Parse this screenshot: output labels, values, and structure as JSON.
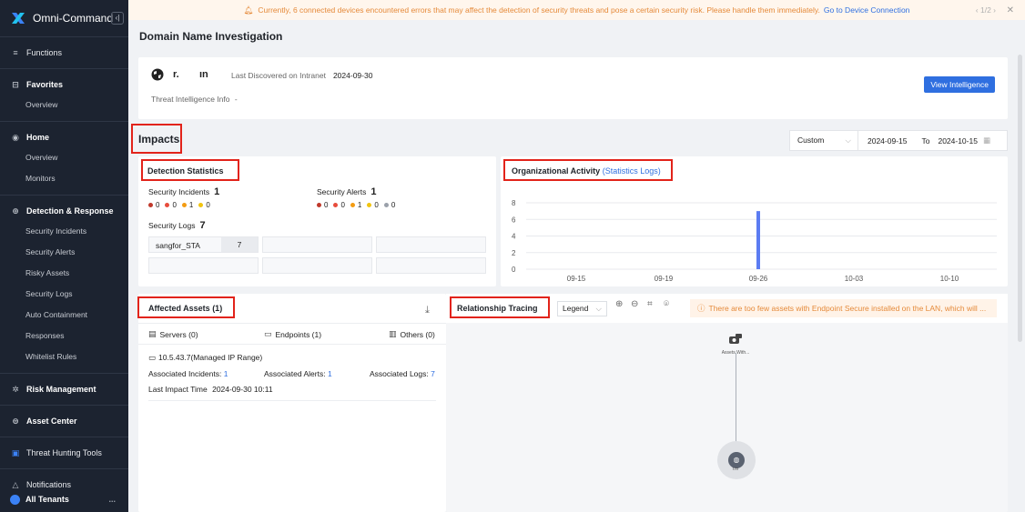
{
  "sidebar": {
    "brand": "Omni-Command",
    "collapse_icon": "‹|",
    "groups": [
      {
        "label": "Functions",
        "icon": "≡"
      },
      {
        "label": "Favorites",
        "icon": "⊟",
        "items": [
          "Overview"
        ]
      },
      {
        "label": "Home",
        "icon": "◉",
        "items": [
          "Overview",
          "Monitors"
        ]
      },
      {
        "label": "Detection & Response",
        "icon": "⊕",
        "items": [
          "Security Incidents",
          "Security Alerts",
          "Risky Assets",
          "Security Logs",
          "Auto Containment",
          "Responses",
          "Whitelist Rules"
        ]
      },
      {
        "label": "Risk Management",
        "icon": "✲"
      },
      {
        "label": "Asset Center",
        "icon": "⊜"
      },
      {
        "label": "Threat Hunting Tools",
        "icon": "▣"
      },
      {
        "label": "Notifications",
        "icon": "△"
      }
    ],
    "tenant": {
      "label": "All Tenants",
      "more": "..."
    }
  },
  "banner": {
    "message": "Currently, 6 connected devices encountered errors that may affect the detection of security threats and pose a certain security risk. Please handle them immediately.",
    "link": "Go to Device Connection",
    "pager": "‹ 1/2 ›",
    "close": "✕"
  },
  "page_title": "Domain Name Investigation",
  "domain": {
    "name_part1": "r.",
    "name_part2": "ın",
    "last_discovered_label": "Last Discovered on Intranet",
    "last_discovered_value": "2024-09-30",
    "threat_info_label": "Threat Intelligence Info",
    "threat_info_value": "-",
    "view_button": "View Intelligence"
  },
  "impacts": {
    "title": "Impacts",
    "filter": {
      "mode": "Custom",
      "from": "2024-09-15",
      "to_label": "To",
      "to": "2024-10-15"
    }
  },
  "detection": {
    "title": "Detection Statistics",
    "incidents_label": "Security Incidents",
    "incidents_count": "1",
    "incidents_dots": [
      "0",
      "0",
      "1",
      "0"
    ],
    "alerts_label": "Security Alerts",
    "alerts_count": "1",
    "alerts_dots": [
      "0",
      "0",
      "1",
      "0",
      "0"
    ],
    "logs_label": "Security Logs",
    "logs_count": "7",
    "log_sources": [
      {
        "name": "sangfor_STA",
        "count": "7"
      }
    ],
    "severity_colors": [
      "#c0392b",
      "#e74c3c",
      "#f39c12",
      "#f1c40f",
      "#9aa0aa"
    ]
  },
  "org_activity": {
    "title": "Organizational Activity",
    "subtitle": "(Statistics Logs)",
    "chart_data": {
      "type": "bar",
      "x_ticks": [
        "09-15",
        "09-19",
        "09-26",
        "10-03",
        "10-10"
      ],
      "y_ticks": [
        0,
        2,
        4,
        6,
        8
      ],
      "ylim": [
        0,
        8
      ],
      "bars": [
        {
          "date": "09-26",
          "value": 7
        }
      ],
      "color": "#5b7cf2"
    }
  },
  "assets": {
    "title": "Affected Assets (1)",
    "download_icon": "⤓",
    "tabs": {
      "servers": "Servers (0)",
      "endpoints": "Endpoints (1)",
      "others": "Others (0)"
    },
    "item": {
      "ip": "10.5.43.7(Managed IP Range)",
      "incidents_label": "Associated Incidents:",
      "incidents_value": "1",
      "alerts_label": "Associated Alerts:",
      "alerts_value": "1",
      "logs_label": "Associated Logs:",
      "logs_value": "7",
      "last_impact_label": "Last Impact Time",
      "last_impact_value": "2024-09-30 10:11"
    }
  },
  "relationship": {
    "title": "Relationship Tracing",
    "legend_label": "Legend",
    "warning": "There are too few assets with Endpoint Secure installed on the LAN, which will ...",
    "node1_label": "Assets With...",
    "node2_label": "r.ln"
  }
}
